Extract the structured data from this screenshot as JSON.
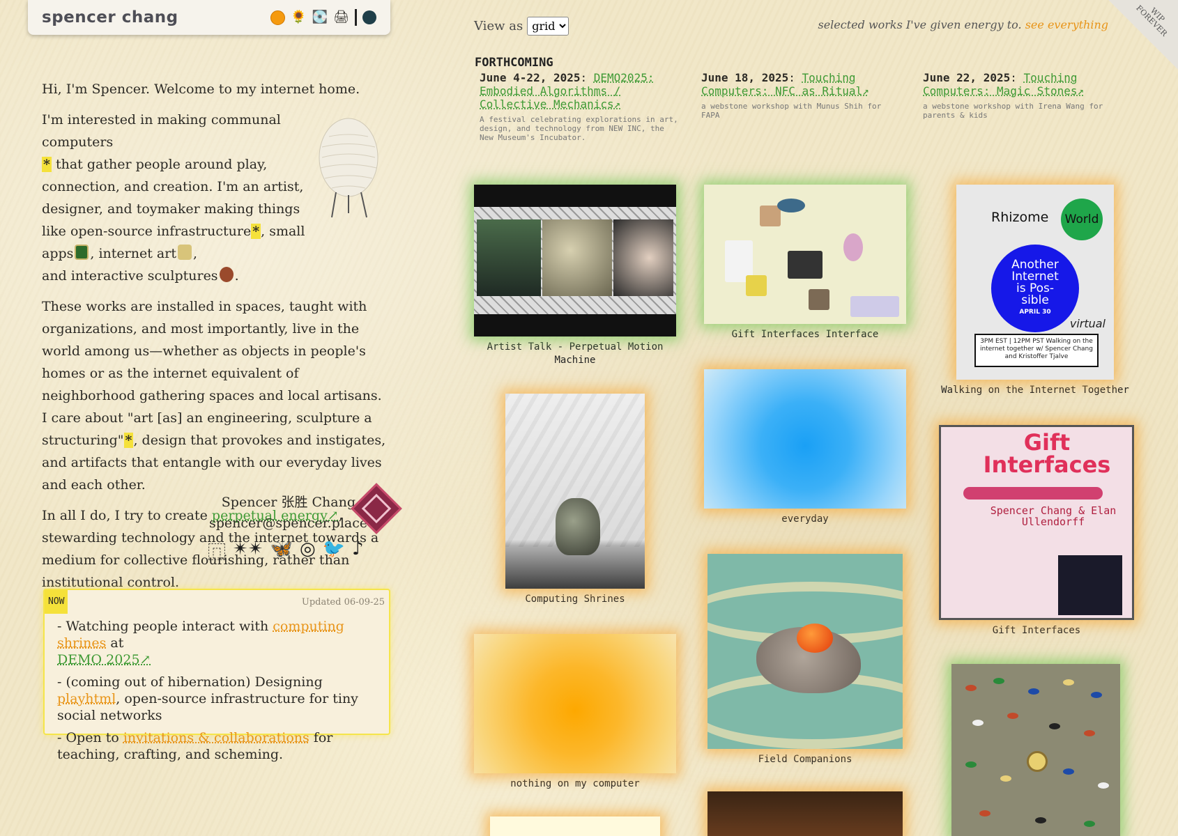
{
  "header": {
    "site_title": "spencer chang",
    "icons": [
      "orange-dot-icon",
      "sunflower-icon",
      "cd-icon",
      "printer-icon",
      "dark-dot-icon"
    ]
  },
  "intro": {
    "p1": "Hi, I'm Spencer. Welcome to my internet home.",
    "p2": {
      "a": "I'm interested in making communal computers",
      "star": "*",
      "b": " that gather people around play, connection, and creation. I'm an artist, designer, and toymaker making things like open-source infrastructure",
      "c": ", small apps",
      "d": ", internet art",
      "e": ",",
      "f": "and interactive sculptures",
      "g": "."
    },
    "p3": {
      "a": "These works are installed in spaces, taught with organizations, and most importantly, live in the world among us—whether as objects in people's homes or as the internet equivalent of neighborhood gathering spaces and local artisans. I care about \"art [as] an engineering, sculpture a structuring\"",
      "b": ", design that provokes and instigates, and artifacts that entangle with our everyday lives and each other."
    },
    "p4": {
      "a": "In all I do, I try to create ",
      "link": "perpetual energy↗",
      "b": ", stewarding technology and the internet towards a medium for collective flourishing, rather than institutional control."
    }
  },
  "signature": {
    "name": "Spencer 张胜 Chang",
    "email": "spencer@spencer.place",
    "socials": [
      "⿵",
      "✴✴",
      "🦋",
      "◎",
      "🐦",
      "♪"
    ]
  },
  "now": {
    "tag": "NOW",
    "updated": "Updated 06-09-25",
    "items": [
      {
        "a": "- Watching people interact with ",
        "link": "computing shrines",
        "b": " at ",
        "link2": "DEMO 2025↗"
      },
      {
        "a": "- (coming out of hibernation) Designing ",
        "link": "playhtml",
        "b": ", open-source infrastructure for tiny social networks"
      },
      {
        "a": "- Open to ",
        "link": "invitations & collaborations",
        "b": " for teaching, crafting, and scheming."
      }
    ]
  },
  "view": {
    "label": "View as",
    "selected": "grid"
  },
  "tagline": {
    "text": "selected works I've given energy to. ",
    "link": "see everything"
  },
  "corner": "WIP FOREVER",
  "forthcoming": {
    "title": "FORTHCOMING",
    "items": [
      {
        "date": "June 4-22, 2025",
        "sep": ": ",
        "link": "DEMO2025: Embodied Algorithms / Collective Mechanics↗",
        "desc": "A festival celebrating explorations in art, design, and technology from NEW INC, the New Museum's Incubator."
      },
      {
        "date": "June 18, 2025",
        "sep": ": ",
        "link": "Touching Computers: NFC as Ritual↗",
        "desc": "a webstone workshop with Munus Shih for FAPA"
      },
      {
        "date": "June 22, 2025",
        "sep": ": ",
        "link": "Touching Computers: Magic Stones↗",
        "desc": "a webstone workshop with Irena Wang for parents & kids"
      }
    ]
  },
  "works": {
    "talk": "Artist Talk - Perpetual Motion Machine",
    "gift_interface": "Gift Interfaces Interface",
    "walking": "Walking on the Internet Together",
    "shrines": "Computing Shrines",
    "everyday": "everyday",
    "gift_interfaces": "Gift Interfaces",
    "field": "Field Companions",
    "nothing": "nothing on my computer"
  },
  "rhizome_poster": {
    "brand": "Rhizome",
    "world": "World",
    "line1": "Another",
    "line2": "Internet",
    "line3": "is Pos-",
    "line4": "sible",
    "date": "APRIL 30",
    "virtual": "virtual",
    "box": "3PM EST | 12PM PST\nWalking on the internet together w/ Spencer Chang and Kristoffer Tjalve"
  },
  "gift_poster": {
    "title": "Gift Interfaces",
    "names": "Spencer Chang & Elan Ullendorff"
  },
  "colors": {
    "accent_green": "#3f9a35",
    "accent_orange": "#e89418",
    "highlight_yellow": "#f5e13a"
  }
}
